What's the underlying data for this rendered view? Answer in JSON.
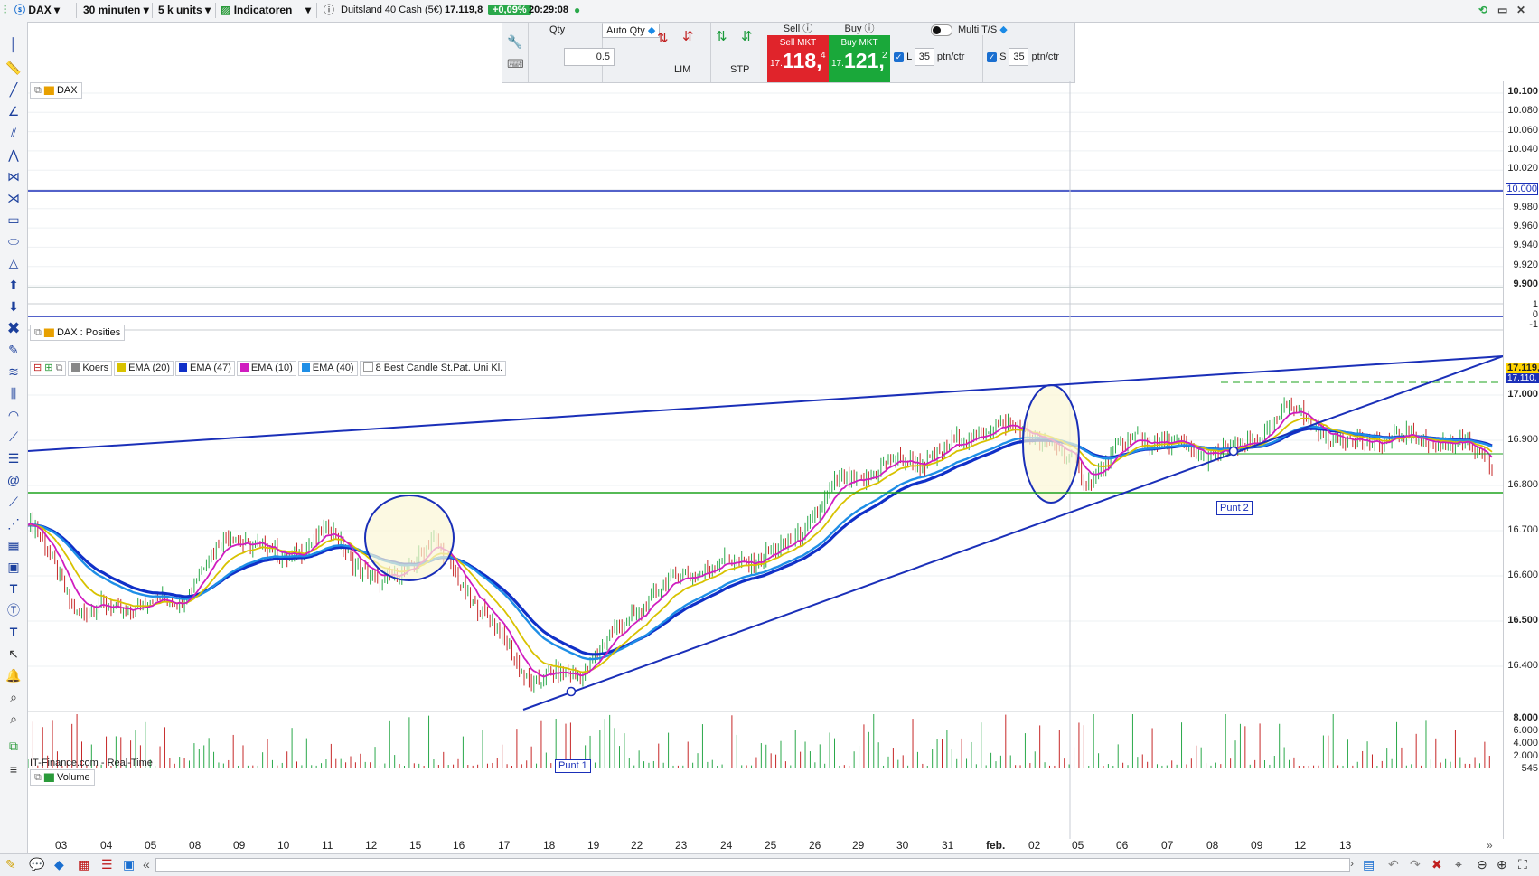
{
  "toolbar": {
    "symbol": "DAX",
    "timeframe": "30 minuten",
    "units": "5 k units",
    "indicators_label": "Indicatoren",
    "instrument_name": "Duitsland 40 Cash (5€)",
    "last_price": "17.119,8",
    "change": "+0,09%",
    "time": "20:29:08"
  },
  "order_panel": {
    "qty_label": "Qty",
    "qty_value": "0.5",
    "auto_qty_label": "Auto Qty",
    "lim_label": "LIM",
    "stp_label": "STP",
    "sell_label": "Sell",
    "buy_label": "Buy",
    "sell_mkt_label": "Sell MKT",
    "buy_mkt_label": "Buy MKT",
    "sell_prefix": "17.",
    "sell_price": "118,",
    "sell_frac": "4",
    "buy_prefix": "17.",
    "buy_price": "121,",
    "buy_frac": "2",
    "multi_ts_label": "Multi T/S",
    "l_label": "L",
    "l_value": "35",
    "l_unit": "ptn/ctr",
    "s_label": "S",
    "s_value": "35",
    "s_unit": "ptn/ctr",
    "colors": {
      "sell": "#e0242b",
      "buy": "#1aa83a"
    }
  },
  "panes": {
    "top_title": "DAX",
    "positions_title": "DAX : Posities",
    "volume_title": "Volume",
    "watermark": "IT-Finance.com - Real-Time"
  },
  "legend": [
    {
      "label": "Koers",
      "color": "#888888"
    },
    {
      "label": "EMA (20)",
      "color": "#d8c200"
    },
    {
      "label": "EMA (47)",
      "color": "#1030c8"
    },
    {
      "label": "EMA (10)",
      "color": "#d01cc0"
    },
    {
      "label": "EMA (40)",
      "color": "#1e8ee6"
    },
    {
      "label": "8 Best Candle St.Pat. Uni Kl.",
      "color": "#ffffff"
    }
  ],
  "top_axis": [
    "10.100",
    "10.080",
    "10.060",
    "10.040",
    "10.020",
    "10.000",
    "9.980",
    "9.960",
    "9.940",
    "9.920",
    "9.900"
  ],
  "top_axis_hl": "10.000",
  "pos_axis": [
    "1",
    "0",
    "-1"
  ],
  "price_axis": [
    "17.000",
    "16.900",
    "16.800",
    "16.700",
    "16.600",
    "16.500",
    "16.400"
  ],
  "price_flag": "17.119,",
  "price_flag2": "17.110,",
  "vol_axis": [
    "8.000",
    "6.000",
    "4.000",
    "2.000",
    "545"
  ],
  "annotations": {
    "p1": "Punt 1",
    "p2": "Punt 2"
  },
  "x_labels": [
    "03",
    "04",
    "05",
    "08",
    "09",
    "10",
    "11",
    "12",
    "15",
    "16",
    "17",
    "18",
    "19",
    "22",
    "23",
    "24",
    "25",
    "26",
    "29",
    "30",
    "31",
    "feb.",
    "02",
    "05",
    "06",
    "07",
    "08",
    "09",
    "12",
    "13"
  ],
  "chart_data": {
    "type": "line",
    "title": "DAX",
    "series_names": [
      "Koers",
      "EMA (20)",
      "EMA (47)",
      "EMA (10)",
      "EMA (40)"
    ],
    "x": [
      "03",
      "04",
      "05",
      "08",
      "09",
      "10",
      "11",
      "12",
      "15",
      "16",
      "17",
      "18",
      "19",
      "22",
      "23",
      "24",
      "25",
      "26",
      "29",
      "30",
      "31",
      "feb.",
      "02",
      "05",
      "06",
      "07",
      "08",
      "09",
      "12",
      "13"
    ],
    "close": [
      16770,
      16560,
      16570,
      16590,
      16740,
      16680,
      16740,
      16610,
      16720,
      16560,
      16400,
      16430,
      16560,
      16650,
      16670,
      16700,
      16840,
      16890,
      16910,
      16980,
      16960,
      16860,
      16960,
      16920,
      16920,
      17020,
      16940,
      16950,
      16950,
      16900
    ],
    "ylim": [
      16350,
      17150
    ],
    "levels": [
      {
        "name": "support",
        "value": 16780
      },
      {
        "name": "resistance",
        "value": 16870
      }
    ]
  }
}
